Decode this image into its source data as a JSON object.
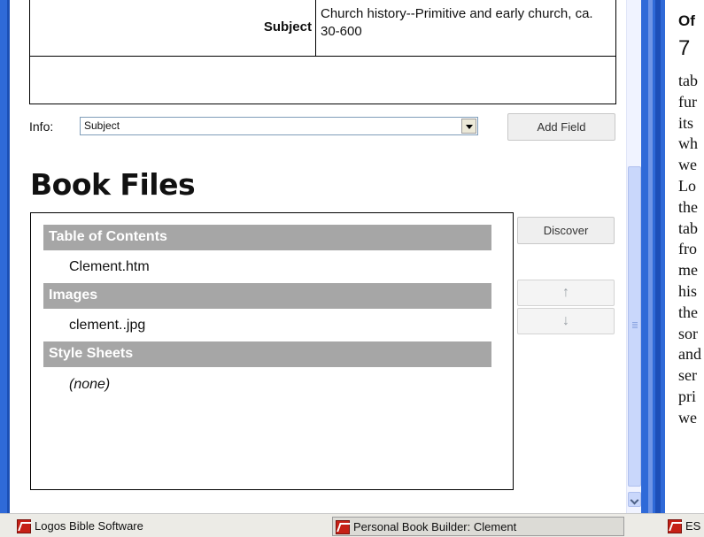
{
  "metadata": {
    "subject_label": "Subject",
    "subject_value": "Church history--Primitive and early church, ca. 30-600"
  },
  "info": {
    "label": "Info:",
    "selected": "Subject",
    "add_field_label": "Add Field"
  },
  "book_files": {
    "title": "Book Files",
    "groups": [
      {
        "header": "Table of Contents",
        "items": [
          "Clement.htm"
        ]
      },
      {
        "header": "Images",
        "items": [
          "clement..jpg"
        ]
      },
      {
        "header": "Style Sheets",
        "items": [
          "(none)"
        ]
      }
    ],
    "discover_label": "Discover",
    "up_icon": "arrow-up-icon",
    "down_icon": "arrow-down-icon"
  },
  "right_panel": {
    "heading": "Of",
    "number": "7",
    "lines": [
      "tab",
      "fur",
      "its",
      "wh",
      "we",
      "Lo",
      "the",
      "tab",
      "fro",
      "me",
      "his",
      "the",
      "sor",
      "and",
      "ser",
      "pri",
      "we"
    ]
  },
  "taskbar": {
    "items": [
      {
        "label": "Logos Bible Software"
      },
      {
        "label": "Personal Book Builder: Clement"
      },
      {
        "label": "ES"
      }
    ]
  },
  "colors": {
    "window_frame": "#2f6ad8",
    "group_header": "#a6a6a6",
    "scroll_thumb": "#c9d7fb"
  }
}
